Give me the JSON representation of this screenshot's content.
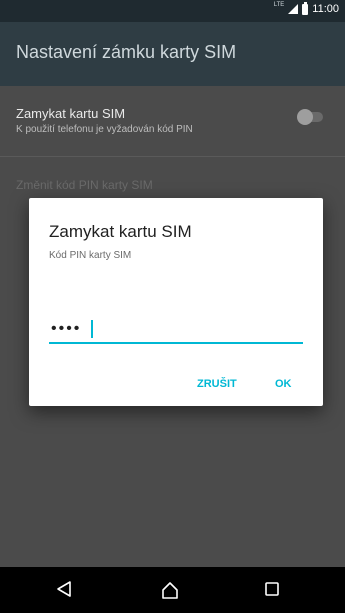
{
  "status_bar": {
    "network": "LTE",
    "time": "11:00",
    "icons": [
      "signal-icon",
      "battery-icon"
    ]
  },
  "app_bar": {
    "title": "Nastavení zámku karty SIM"
  },
  "settings": {
    "lock_sim": {
      "title": "Zamykat kartu SIM",
      "summary": "K použití telefonu je vyžadován kód PIN",
      "checked": false
    },
    "change_pin": {
      "title": "Změnit kód PIN karty SIM",
      "enabled": false
    }
  },
  "dialog": {
    "title": "Zamykat kartu SIM",
    "message": "Kód PIN karty SIM",
    "pin_value": "••••",
    "cancel_label": "ZRUŠIT",
    "ok_label": "OK"
  },
  "nav": {
    "icons": [
      "back-icon",
      "home-icon",
      "recent-apps-icon"
    ]
  },
  "colors": {
    "accent": "#00b8d4",
    "app_bar": "#2f3d44",
    "status_bar": "#1f2a30"
  }
}
